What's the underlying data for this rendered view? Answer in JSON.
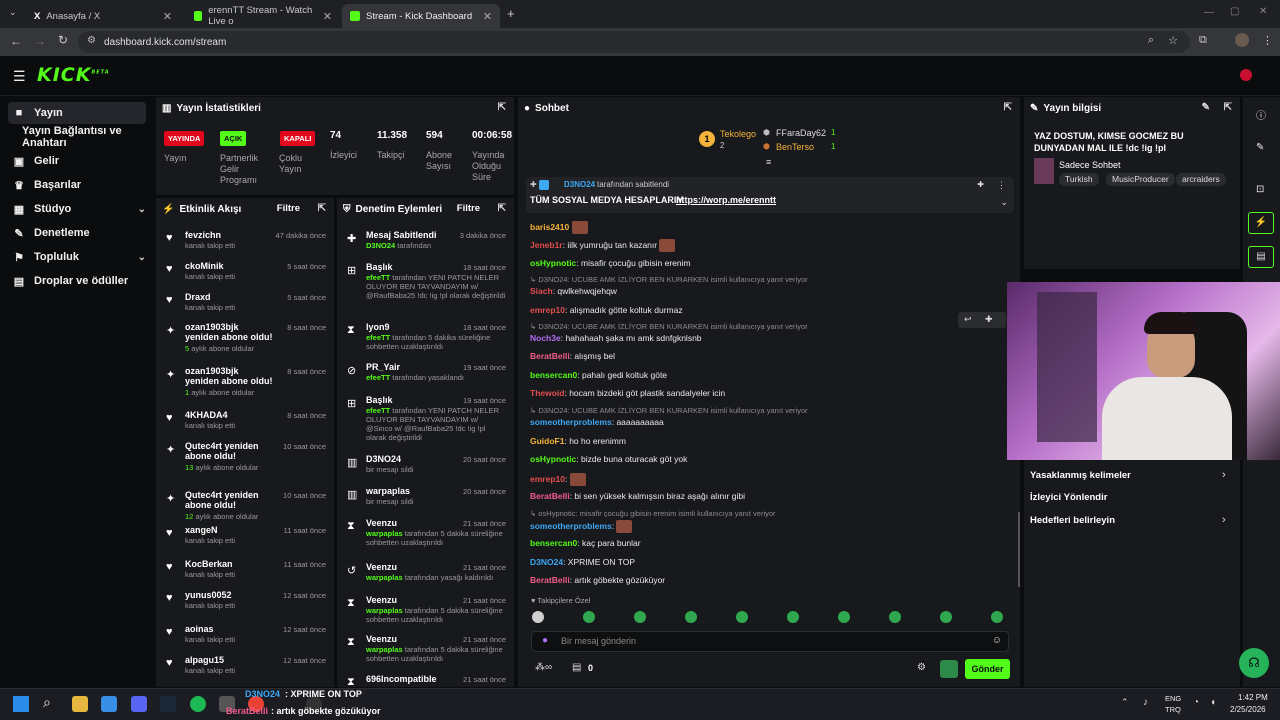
{
  "browser": {
    "tabs": [
      {
        "title": "Anasayfa / X",
        "icon": "x-icon"
      },
      {
        "title": "erennTT Stream - Watch Live o",
        "icon": "kick-icon"
      },
      {
        "title": "Stream - Kick Dashboard",
        "icon": "kick-icon"
      }
    ],
    "new_tab": "+",
    "url": "dashboard.kick.com/stream"
  },
  "kick": {
    "logo": "KICK",
    "logo_sup": "BETA"
  },
  "sidebar": {
    "items": [
      {
        "label": "Yayın",
        "icon": "camera-icon"
      },
      {
        "label": "Yayın Bağlantısı ve Anahtarı",
        "icon": ""
      },
      {
        "label": "Gelir",
        "icon": "dollar-icon"
      },
      {
        "label": "Başarılar",
        "icon": "trophy-icon"
      },
      {
        "label": "Stüdyo",
        "icon": "grid-icon"
      },
      {
        "label": "Denetleme",
        "icon": "wrench-icon"
      },
      {
        "label": "Topluluk",
        "icon": "people-icon"
      },
      {
        "label": "Droplar ve ödüller",
        "icon": "gift-icon"
      }
    ]
  },
  "stats": {
    "title": "Yayın İstatistikleri",
    "badges": [
      {
        "text": "YAYINDA",
        "label": "Yayın",
        "color": "#e1071c"
      },
      {
        "text": "AÇIK",
        "label": "Partnerlik Gelir Programı",
        "color": "#53fc18"
      },
      {
        "text": "KAPALI",
        "label": "Çoklu Yayın",
        "color": "#e1071c"
      }
    ],
    "numbers": [
      {
        "value": "74",
        "label": "İzleyici"
      },
      {
        "value": "11.358",
        "label": "Takipçi"
      },
      {
        "value": "594",
        "label": "Abone Sayısı"
      },
      {
        "value": "00:06:58",
        "label": "Yayında Olduğu Süre"
      }
    ]
  },
  "activity": {
    "title": "Etkinlik Akışı",
    "filter": "Filtre",
    "rows": [
      {
        "name": "fevzichn",
        "sub": "kanalı takip etti",
        "time": "47 dakika önce",
        "icon": "heart"
      },
      {
        "name": "ckoMinik",
        "sub": "kanalı takip etti",
        "time": "5 saat önce",
        "icon": "heart"
      },
      {
        "name": "Draxd",
        "sub": "kanalı takip etti",
        "time": "5 saat önce",
        "icon": "heart"
      },
      {
        "name": "ozan1903bjk yeniden abone oldu!",
        "sub_green": "5",
        "sub": "aylık abone oldular",
        "time": "8 saat önce",
        "icon": "star"
      },
      {
        "name": "ozan1903bjk yeniden abone oldu!",
        "sub_green": "1",
        "sub": "aylık abone oldular",
        "time": "8 saat önce",
        "icon": "star"
      },
      {
        "name": "4KHADA4",
        "sub": "kanalı takip etti",
        "time": "8 saat önce",
        "icon": "heart"
      },
      {
        "name": "Qutec4rt yeniden abone oldu!",
        "sub_green": "13",
        "sub": "aylık abone oldular",
        "time": "10 saat önce",
        "icon": "star"
      },
      {
        "name": "Qutec4rt yeniden abone oldu!",
        "sub_green": "12",
        "sub": "aylık abone oldular",
        "time": "10 saat önce",
        "icon": "star"
      },
      {
        "name": "xangeN",
        "sub": "kanalı takip etti",
        "time": "11 saat önce",
        "icon": "heart"
      },
      {
        "name": "KocBerkan",
        "sub": "kanalı takip etti",
        "time": "11 saat önce",
        "icon": "heart"
      },
      {
        "name": "yunus0052",
        "sub": "kanalı takip etti",
        "time": "12 saat önce",
        "icon": "heart"
      },
      {
        "name": "aoinas",
        "sub": "kanalı takip etti",
        "time": "12 saat önce",
        "icon": "heart"
      },
      {
        "name": "alpagu15",
        "sub": "kanalı takip etti",
        "time": "12 saat önce",
        "icon": "heart"
      }
    ]
  },
  "moderation": {
    "title": "Denetim Eylemleri",
    "filter": "Filtre",
    "rows": [
      {
        "name": "Mesaj Sabitlendi",
        "by": "D3NO24",
        "sub": "tarafından",
        "time": "3 dakika önce",
        "icon": "pin"
      },
      {
        "name": "Başlık",
        "by": "efeeTT",
        "sub": "tarafından YENI PATCH NELER OLUYOR BEN TAYVANDAYIM w/ @RaufBaba25 !dc !ig !pl olarak değiştirildi",
        "time": "18 saat önce",
        "icon": "title"
      },
      {
        "name": "lyon9",
        "by": "efeeTT",
        "sub": "tarafından 5 dakika süreliğine sohbetten uzaklaştırıldı",
        "time": "18 saat önce",
        "icon": "hourglass"
      },
      {
        "name": "PR_Yair",
        "by": "efeeTT",
        "sub": "tarafından yasaklandı",
        "time": "19 saat önce",
        "icon": "ban"
      },
      {
        "name": "Başlık",
        "by": "efeeTT",
        "sub": "tarafından YENI PATCH NELER OLUYOR BEN TAYVANDAYIM w/ @Sinco w/ @RaufBaba25 !dc !ig !pl olarak değiştirildi",
        "time": "19 saat önce",
        "icon": "title"
      },
      {
        "name": "D3NO24",
        "by": "",
        "sub": "bir mesajı sildi",
        "time": "20 saat önce",
        "icon": "trash"
      },
      {
        "name": "warpaplas",
        "by": "",
        "sub": "bir mesajı sildi",
        "time": "20 saat önce",
        "icon": "trash"
      },
      {
        "name": "Veenzu",
        "by": "warpaplas",
        "sub": "tarafından 5 dakika süreliğine sohbetten uzaklaştırıldı",
        "time": "21 saat önce",
        "icon": "hourglass"
      },
      {
        "name": "Veenzu",
        "by": "warpaplas",
        "sub": "tarafından yasağı kaldırıldı",
        "time": "21 saat önce",
        "icon": "undo"
      },
      {
        "name": "Veenzu",
        "by": "warpaplas",
        "sub": "tarafından 5 dakika süreliğine sohbetten uzaklaştırıldı",
        "time": "21 saat önce",
        "icon": "hourglass"
      },
      {
        "name": "Veenzu",
        "by": "warpaplas",
        "sub": "tarafından 5 dakika süreliğine sohbetten uzaklaştırıldı",
        "time": "21 saat önce",
        "icon": "hourglass"
      },
      {
        "name": "696Incompatible",
        "by": "",
        "sub": "",
        "time": "21 saat önce",
        "icon": "hourglass"
      }
    ]
  },
  "chat": {
    "title": "Sohbet",
    "leaderboard": [
      {
        "rank": "1",
        "name": "Tekolego",
        "count": "2"
      },
      {
        "name": "FFaraDay62",
        "count": "1"
      },
      {
        "name": "BenTerso",
        "count": "1"
      }
    ],
    "pinned": {
      "by": "D3NO24",
      "by_sub": "tarafından sabitlendi",
      "text": "TÜM SOSYAL MEDYA HESAPLARIM",
      "link": "https://worp.me/erenntt"
    },
    "messages": [
      {
        "user": "baris2410",
        "text": "",
        "color": "#f4b33a",
        "emote": true
      },
      {
        "user": "Jeneb1r",
        "text": ": iilk yumruğu tan kazanır",
        "color": "#e14e4e",
        "emote": true
      },
      {
        "user": "osHypnotic",
        "text": ": misafir çocuğu gibisin erenim",
        "color": "#53fc18"
      },
      {
        "reply": "D3NO24: UCUBE AMK İZLİYOR BEN KURARKEN isimli kullanıcıya yanıt veriyor"
      },
      {
        "user": "Siach",
        "text": ": qwlkehwqjehqw",
        "color": "#e14e4e"
      },
      {
        "user": "emrep10",
        "text": ": alışmadık götte koltuk durmaz",
        "color": "#e14e4e"
      },
      {
        "reply": "D3NO24: UCUBE AMK İZLİYOR BEN KURARKEN isimli kullanıcıya yanıt veriyor"
      },
      {
        "user": "Noch3e",
        "text": ": hahahaah şaka mı amk sdnfgknlsnb",
        "color": "#b26cf5"
      },
      {
        "user": "BeratBelli",
        "text": ": alışmış bel",
        "color": "#f15b8a"
      },
      {
        "user": "bensercan0",
        "text": ": pahalı gedi koltuk göte",
        "color": "#53fc18"
      },
      {
        "user": "Thewoid",
        "text": ": hocam bizdeki göt plastik sandalyeler icin",
        "color": "#e14e4e"
      },
      {
        "reply": "D3NO24: UCUBE AMK İZLİYOR BEN KURARKEN isimli kullanıcıya yanıt veriyor"
      },
      {
        "user": "someotherproblems",
        "text": ": aaaaaaaaaa",
        "color": "#3ea8f5"
      },
      {
        "user": "GuidoF1",
        "text": ": ho ho erenimm",
        "color": "#f4b33a"
      },
      {
        "user": "osHypnotic",
        "text": ": bizde buna oturacak göt yok",
        "color": "#53fc18"
      },
      {
        "user": "emrep10",
        "text": ":",
        "color": "#e14e4e",
        "emote": true
      },
      {
        "user": "BeratBelli",
        "text": ": bi sen yüksek kalmışsın biraz aşağı alınır gibi",
        "color": "#f15b8a"
      },
      {
        "reply": "osHypnotic: misafir çocuğu gibisin erenim isimli kullanıcıya yanıt veriyor"
      },
      {
        "user": "someotherproblems",
        "text": ":",
        "color": "#3ea8f5",
        "emote": true
      },
      {
        "user": "bensercan0",
        "text": ": kaç para bunlar",
        "color": "#53fc18"
      },
      {
        "user": "D3NO24",
        "text": ": XPRIME ON TOP",
        "color": "#3ea8f5"
      },
      {
        "user": "BeratBelli",
        "text": ": artık göbekte gözüküyor",
        "color": "#f15b8a"
      }
    ],
    "followers_only": "Takipçilere Özel",
    "input_placeholder": "Bir mesaj gönderin",
    "points": "0",
    "send": "Gönder"
  },
  "streaminfo": {
    "title": "Yayın bilgisi",
    "stream_title": "YAZ DOSTUM, KIMSE GOCMEZ BU DUNYADAN MAL ILE !dc !ig !pl",
    "category": "Sadece Sohbet",
    "tags": [
      "Turkish",
      "MusicProducer",
      "arcraiders"
    ],
    "links": [
      "Yasaklanmış kelimeler",
      "İzleyici Yönlendir",
      "Hedefleri belirleyin"
    ]
  },
  "taskbar": {
    "overlay_user": "D3NO24",
    "overlay_text": ": XPRIME ON TOP",
    "overlay_user2": "BeratBelli",
    "overlay_text2": ": artık göbekte gözüküyor",
    "lang": "ENG",
    "region": "TRQ",
    "time": "1:42 PM",
    "date": "2/25/2026"
  },
  "colors": {
    "kick_green": "#53fc18",
    "live_red": "#e1071c",
    "panel": "#18191c"
  }
}
